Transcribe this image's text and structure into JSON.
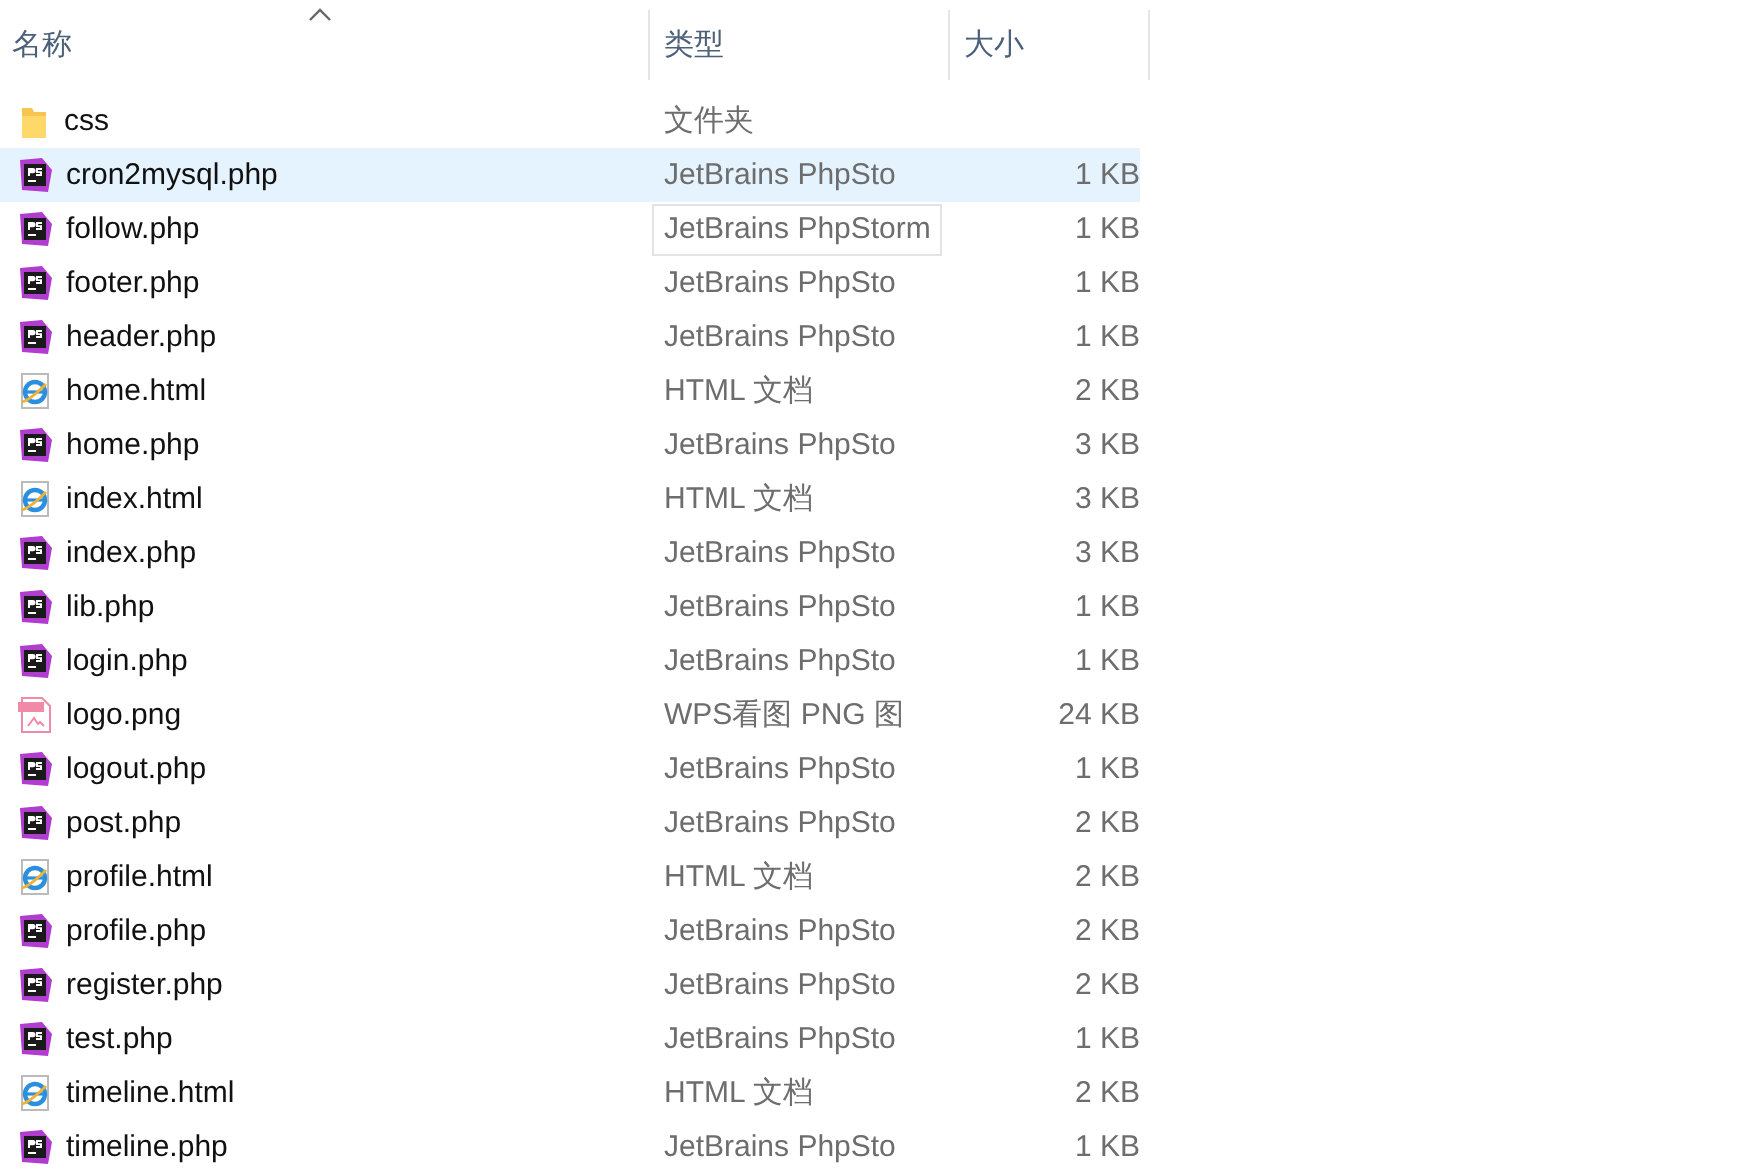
{
  "columns": [
    {
      "label": "名称",
      "sorted": true
    },
    {
      "label": "类型",
      "sorted": false
    },
    {
      "label": "大小",
      "sorted": false
    }
  ],
  "rows": [
    {
      "kind": "folder",
      "name": "css",
      "type": "文件夹",
      "selected": false
    },
    {
      "kind": "phpstorm",
      "name": "cron2mysql.php",
      "type": "JetBrains PhpSto",
      "size": "1 KB",
      "selected": true
    },
    {
      "kind": "phpstorm",
      "name": "follow.php",
      "size": "1 KB",
      "selected": false,
      "tooltip": "JetBrains PhpStorm"
    },
    {
      "kind": "phpstorm",
      "name": "footer.php",
      "type": "JetBrains PhpSto",
      "size": "1 KB",
      "selected": false
    },
    {
      "kind": "phpstorm",
      "name": "header.php",
      "type": "JetBrains PhpSto",
      "size": "1 KB",
      "selected": false
    },
    {
      "kind": "browser",
      "name": "home.html",
      "type": "HTML 文档",
      "size": "2 KB",
      "selected": false
    },
    {
      "kind": "phpstorm",
      "name": "home.php",
      "type": "JetBrains PhpSto",
      "size": "3 KB",
      "selected": false
    },
    {
      "kind": "browser",
      "name": "index.html",
      "type": "HTML 文档",
      "size": "3 KB",
      "selected": false
    },
    {
      "kind": "phpstorm",
      "name": "index.php",
      "type": "JetBrains PhpSto",
      "size": "3 KB",
      "selected": false
    },
    {
      "kind": "phpstorm",
      "name": "lib.php",
      "type": "JetBrains PhpSto",
      "size": "1 KB",
      "selected": false
    },
    {
      "kind": "phpstorm",
      "name": "login.php",
      "type": "JetBrains PhpSto",
      "size": "1 KB",
      "selected": false
    },
    {
      "kind": "image",
      "name": "logo.png",
      "type": "WPS看图 PNG 图",
      "size": "24 KB",
      "selected": false
    },
    {
      "kind": "phpstorm",
      "name": "logout.php",
      "type": "JetBrains PhpSto",
      "size": "1 KB",
      "selected": false
    },
    {
      "kind": "phpstorm",
      "name": "post.php",
      "type": "JetBrains PhpSto",
      "size": "2 KB",
      "selected": false
    },
    {
      "kind": "browser",
      "name": "profile.html",
      "type": "HTML 文档",
      "size": "2 KB",
      "selected": false
    },
    {
      "kind": "phpstorm",
      "name": "profile.php",
      "type": "JetBrains PhpSto",
      "size": "2 KB",
      "selected": false
    },
    {
      "kind": "phpstorm",
      "name": "register.php",
      "type": "JetBrains PhpSto",
      "size": "2 KB",
      "selected": false
    },
    {
      "kind": "phpstorm",
      "name": "test.php",
      "type": "JetBrains PhpSto",
      "size": "1 KB",
      "selected": false
    },
    {
      "kind": "browser",
      "name": "timeline.html",
      "type": "HTML 文档",
      "size": "2 KB",
      "selected": false
    },
    {
      "kind": "phpstorm",
      "name": "timeline.php",
      "type": "JetBrains PhpSto",
      "size": "1 KB",
      "selected": false
    }
  ]
}
